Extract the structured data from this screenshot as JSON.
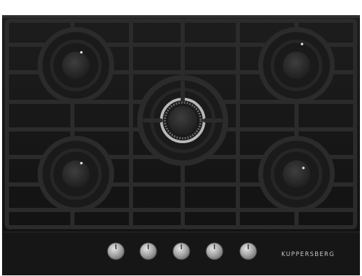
{
  "product": {
    "brand_label": "KUPPERSBERG",
    "burner_count": 5,
    "knob_count": 5
  },
  "colors": {
    "glass": "#141414",
    "grate": "#2b2b2b",
    "grate_shadow": "#0a0a0a",
    "burner_cap": "#2e2e2e",
    "chrome_ring": "#b8b8b8",
    "knob": "#a9a9a9",
    "brand_text": "#c9c9c9"
  },
  "icons": [
    "gas-burner-icon",
    "control-knob-icon"
  ]
}
